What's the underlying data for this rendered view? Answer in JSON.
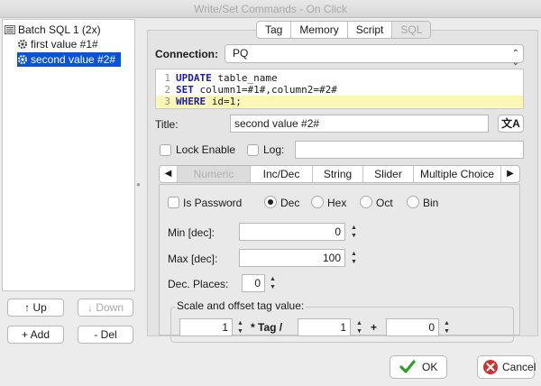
{
  "window": {
    "title": "Write/Set Commands - On Click"
  },
  "tree": {
    "root_label": "Batch SQL 1 (2x)",
    "items": [
      {
        "label": "first value #1#",
        "selected": false
      },
      {
        "label": "second value #2#",
        "selected": true
      }
    ]
  },
  "side_buttons": {
    "up": "↑ Up",
    "down": "↓ Down",
    "add": "+ Add",
    "del": "- Del"
  },
  "top_tabs": [
    "Tag",
    "Memory",
    "Script",
    "SQL"
  ],
  "connection": {
    "label": "Connection:",
    "value": "PQ"
  },
  "sql_lines": [
    {
      "num": "1",
      "kw": "UPDATE",
      "rest": " table_name"
    },
    {
      "num": "2",
      "kw": "SET",
      "rest": " column1=#1#,column2=#2#"
    },
    {
      "num": "3",
      "kw": "WHERE",
      "rest": " id=1;"
    }
  ],
  "title_field": {
    "label": "Title:",
    "value": "second value #2#"
  },
  "lock_enable": {
    "label": "Lock Enable",
    "checked": false
  },
  "log": {
    "label": "Log:",
    "value": ""
  },
  "sub_tabs": [
    "Numeric",
    "Inc/Dec",
    "String",
    "Slider",
    "Multiple Choice"
  ],
  "numeric": {
    "is_password": {
      "label": "Is Password",
      "checked": false
    },
    "formats": [
      {
        "label": "Dec",
        "checked": true
      },
      {
        "label": "Hex",
        "checked": false
      },
      {
        "label": "Oct",
        "checked": false
      },
      {
        "label": "Bin",
        "checked": false
      }
    ],
    "min": {
      "label": "Min [dec]:",
      "value": "0"
    },
    "max": {
      "label": "Max [dec]:",
      "value": "100"
    },
    "dec_places": {
      "label": "Dec. Places:",
      "value": "0"
    },
    "scale": {
      "label": "Scale and offset tag value:",
      "factor": "1",
      "op1": "* Tag /",
      "divisor": "1",
      "op2": "+",
      "offset": "0"
    }
  },
  "footer": {
    "ok": "OK",
    "cancel": "Cancel"
  },
  "colors": {
    "selection": "#0a53d6",
    "highlight": "#fdf7b7",
    "keyword": "#1b1bb5",
    "ok_icon": "#2f9e2f",
    "cancel_icon": "#d32f2f"
  }
}
